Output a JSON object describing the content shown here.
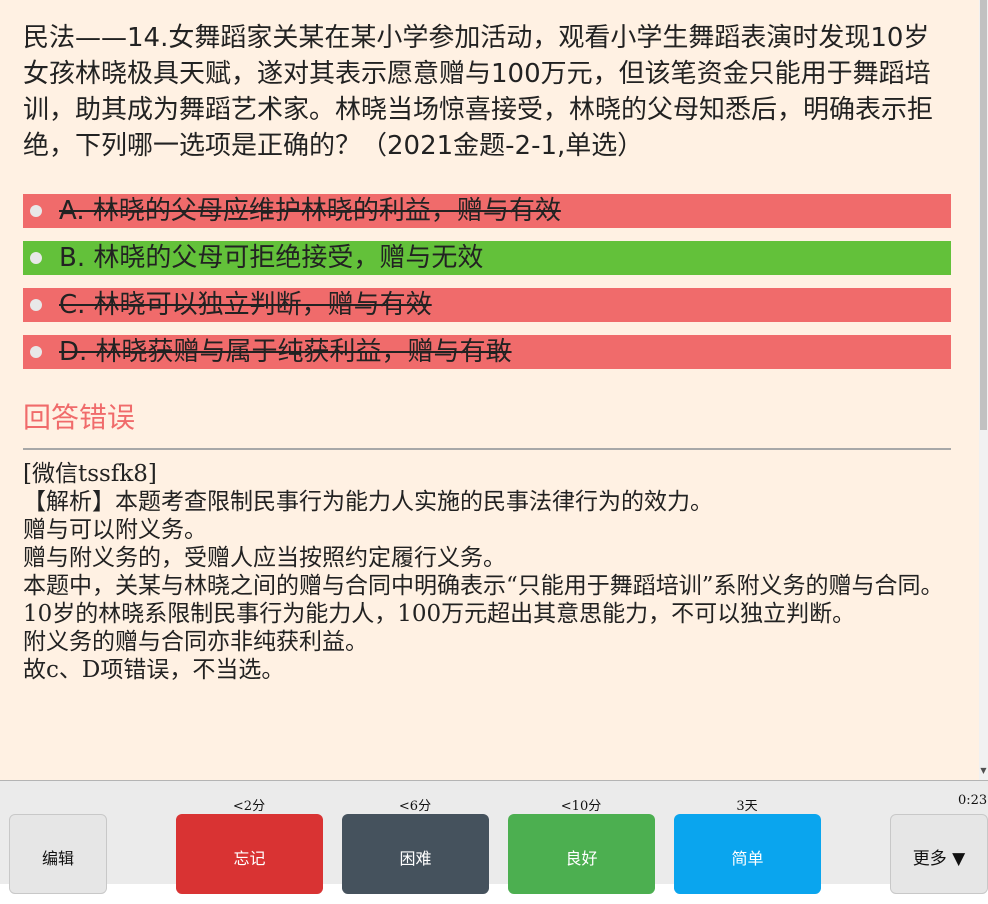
{
  "question": "民法——14.女舞蹈家关某在某小学参加活动，观看小学生舞蹈表演时发现10岁女孩林晓极具天赋，遂对其表示愿意赠与100万元，但该笔资金只能用于舞蹈培训，助其成为舞蹈艺术家。林晓当场惊喜接受，林晓的父母知悉后，明确表示拒绝，下列哪一选项是正确的？（2021金题-2-1,单选）",
  "options": [
    {
      "text": "A. 林晓的父母应维护林晓的利益，赠与有效",
      "state": "wrong"
    },
    {
      "text": "B. 林晓的父母可拒绝接受，赠与无效",
      "state": "correct"
    },
    {
      "text": "C. 林晓可以独立判断，赠与有效",
      "state": "wrong"
    },
    {
      "text": "D. 林晓获赠与属于纯获利益，赠与有敢",
      "state": "wrong"
    }
  ],
  "result_text": "回答错误",
  "explanation": [
    "[微信tssfk8]",
    "【解析】本题考查限制民事行为能力人实施的民事法律行为的效力。",
    "赠与可以附义务。",
    "赠与附义务的，受赠人应当按照约定履行义务。",
    "本题中，关某与林晓之间的赠与合同中明确表示“只能用于舞蹈培训”系附义务的赠与合同。",
    "10岁的林晓系限制民事行为能力人，100万元超出其意思能力，不可以独立判断。",
    "附义务的赠与合同亦非纯获利益。",
    "故c、D项错误，不当选。"
  ],
  "bottom_bar": {
    "edit_label": "编辑",
    "more_label": "更多 ▼",
    "timer": "0:23",
    "again": {
      "label": "忘记",
      "interval": "<2分"
    },
    "hard": {
      "label": "困难",
      "interval": "<6分"
    },
    "good": {
      "label": "良好",
      "interval": "<10分"
    },
    "easy": {
      "label": "简单",
      "interval": "3天"
    }
  },
  "colors": {
    "card_bg": "#fff1e3",
    "wrong": "#f06b6b",
    "correct": "#63c13a",
    "again": "#d93333",
    "hard": "#45525d",
    "good": "#4caf50",
    "easy": "#0aa5ee"
  },
  "icons": {
    "option_marker": "radio-dot-icon",
    "scroll_down": "triangle-down-icon"
  }
}
